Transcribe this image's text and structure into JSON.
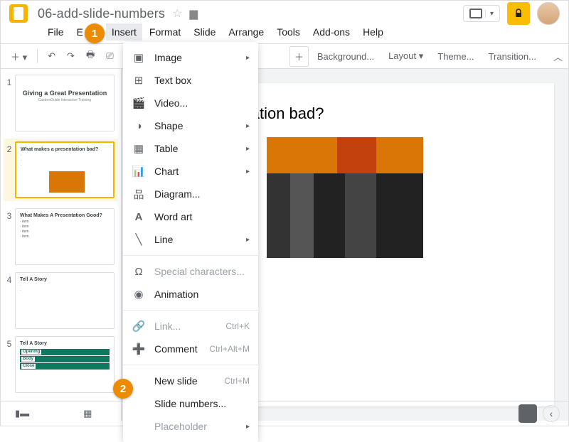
{
  "document": {
    "title": "06-add-slide-numbers"
  },
  "menu": {
    "file": "File",
    "edit": "E",
    "view": "",
    "insert": "Insert",
    "format": "Format",
    "slide": "Slide",
    "arrange": "Arrange",
    "tools": "Tools",
    "addons": "Add-ons",
    "help": "Help"
  },
  "toolbar": {
    "background": "Background...",
    "layout": "Layout",
    "theme": "Theme...",
    "transition": "Transition..."
  },
  "insertMenu": {
    "image": "Image",
    "textbox": "Text box",
    "video": "Video...",
    "shape": "Shape",
    "table": "Table",
    "chart": "Chart",
    "diagram": "Diagram...",
    "wordart": "Word art",
    "line": "Line",
    "specialchars": "Special characters...",
    "animation": "Animation",
    "link": "Link...",
    "link_shortcut": "Ctrl+K",
    "comment": "Comment",
    "comment_shortcut": "Ctrl+Alt+M",
    "newslide": "New slide",
    "newslide_shortcut": "Ctrl+M",
    "slidenumbers": "Slide numbers...",
    "placeholder": "Placeholder"
  },
  "thumbs": {
    "s1": {
      "num": "1",
      "title": "Giving a Great Presentation",
      "sub": "CustomGuide Interactive Training"
    },
    "s2": {
      "num": "2",
      "title": "What makes a presentation bad?"
    },
    "s3": {
      "num": "3",
      "title": "What Makes A Presentation Good?"
    },
    "s4": {
      "num": "4",
      "title": "Tell A Story"
    },
    "s5": {
      "num": "5",
      "title": "Tell A Story",
      "b1": "Opening",
      "b2": "Body",
      "b3": "Close"
    }
  },
  "slide": {
    "heading": "a presentation bad?"
  },
  "badges": {
    "one": "1",
    "two": "2"
  }
}
